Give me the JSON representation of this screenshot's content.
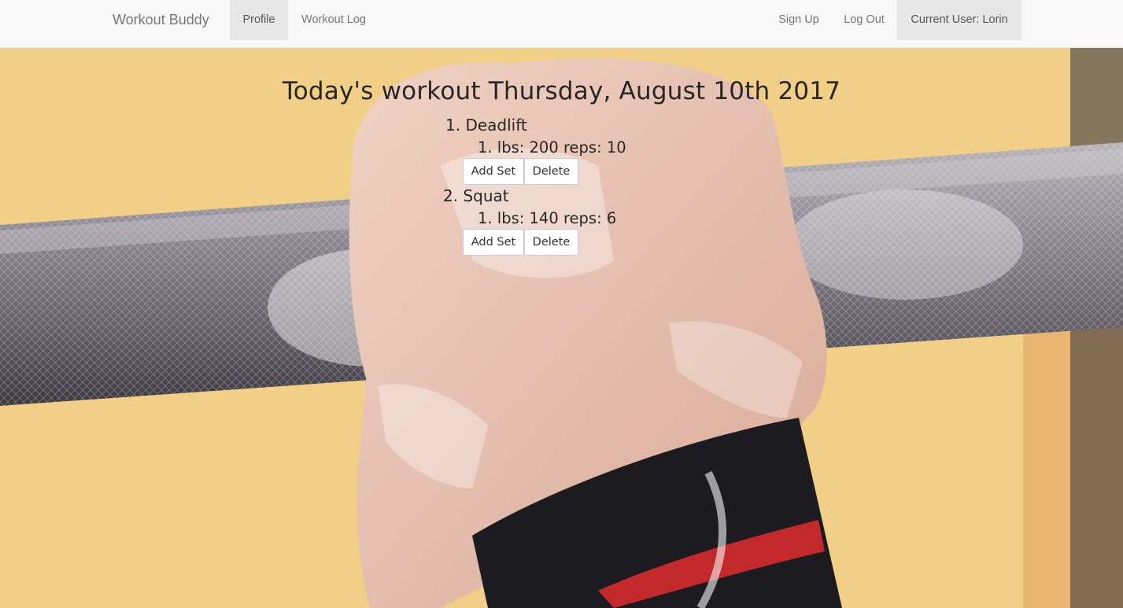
{
  "nav": {
    "brand": "Workout Buddy",
    "profile": "Profile",
    "workout_log": "Workout Log",
    "sign_up": "Sign Up",
    "log_out": "Log Out",
    "current_user": "Current User: Lorin"
  },
  "workout": {
    "title": "Today's workout Thursday, August 10th 2017",
    "exercises": [
      {
        "label": "1. Deadlift",
        "sets": [
          "1. lbs: 200 reps: 10"
        ],
        "add_set_label": "Add Set",
        "delete_label": "Delete"
      },
      {
        "label": "2. Squat",
        "sets": [
          "1. lbs: 140 reps: 6"
        ],
        "add_set_label": "Add Set",
        "delete_label": "Delete"
      }
    ]
  },
  "colors": {
    "navbar_bg": "#f8f8f8",
    "active_nav_bg": "#e7e7e7",
    "background_warm": "#f1cd85"
  }
}
